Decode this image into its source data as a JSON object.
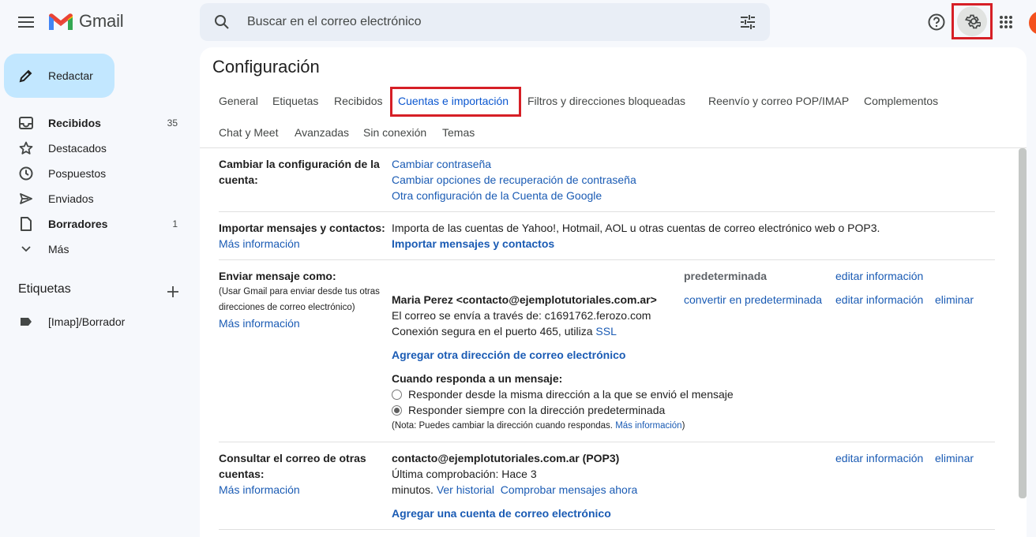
{
  "app": {
    "name": "Gmail"
  },
  "search": {
    "placeholder": "Buscar en el correo electrónico"
  },
  "compose": {
    "label": "Redactar"
  },
  "sidebar": {
    "items": [
      {
        "label": "Recibidos",
        "count": "35",
        "icon": "inbox-icon"
      },
      {
        "label": "Destacados",
        "count": "",
        "icon": "star-icon"
      },
      {
        "label": "Pospuestos",
        "count": "",
        "icon": "clock-icon"
      },
      {
        "label": "Enviados",
        "count": "",
        "icon": "send-icon"
      },
      {
        "label": "Borradores",
        "count": "1",
        "icon": "draft-icon"
      },
      {
        "label": "Más",
        "count": "",
        "icon": "chevron-down-icon"
      }
    ],
    "labels_title": "Etiquetas",
    "labels": [
      {
        "label": "[Imap]/Borrador",
        "icon": "label-icon"
      }
    ]
  },
  "settings": {
    "title": "Configuración",
    "tabs": [
      "General",
      "Etiquetas",
      "Recibidos",
      "Cuentas e importación",
      "Filtros y direcciones bloqueadas",
      "Reenvío y correo POP/IMAP",
      "Complementos",
      "Chat y Meet",
      "Avanzadas",
      "Sin conexión",
      "Temas"
    ],
    "active_tab": "Cuentas e importación",
    "account": {
      "label_line1": "Cambiar la configuración de la",
      "label_line2": "cuenta:",
      "links": [
        "Cambiar contraseña",
        "Cambiar opciones de recuperación de contraseña",
        "Otra configuración de la Cuenta de Google"
      ]
    },
    "import": {
      "label": "Importar mensajes y contactos:",
      "more": "Más información",
      "desc": "Importa de las cuentas de Yahoo!, Hotmail, AOL u otras cuentas de correo electrónico web o POP3.",
      "action": "Importar mensajes y contactos"
    },
    "send_as": {
      "label": "Enviar mensaje como:",
      "sub1": "(Usar Gmail para enviar desde tus otras",
      "sub2": "direcciones de correo electrónico)",
      "more": "Más información",
      "default_label": "predeterminada",
      "edit1": "editar información",
      "address": "Maria Perez <contacto@ejemplotutoriales.com.ar>",
      "make_default": "convertir en predeterminada",
      "edit2": "editar información",
      "delete": "eliminar",
      "via": "El correo se envía a través de: c1691762.ferozo.com",
      "secure_prefix": "Conexión segura en el puerto 465, utiliza",
      "secure_link": "SSL",
      "add": "Agregar otra dirección de correo electrónico",
      "reply_title": "Cuando responda a un mensaje:",
      "reply_opt1": "Responder desde la misma dirección a la que se envió el mensaje",
      "reply_opt2": "Responder siempre con la dirección predeterminada",
      "note_prefix": "(Nota: Puedes cambiar la dirección cuando respondas.",
      "note_link": "Más información",
      "note_suffix": ")"
    },
    "check_mail": {
      "label_line1": "Consultar el correo de otras",
      "label_line2": "cuentas:",
      "more": "Más información",
      "account": "contacto@ejemplotutoriales.com.ar (POP3)",
      "last_check1": "Última comprobación: Hace 3",
      "last_check2": "minutos.",
      "history": "Ver historial",
      "check_now": "Comprobar mensajes ahora",
      "edit": "editar información",
      "delete": "eliminar",
      "add": "Agregar una cuenta de correo electrónico"
    }
  },
  "colors": {
    "accent": "#0b57d0",
    "link": "#1a5bb4",
    "highlight": "#d61f26",
    "compose_bg": "#c2e7ff"
  }
}
